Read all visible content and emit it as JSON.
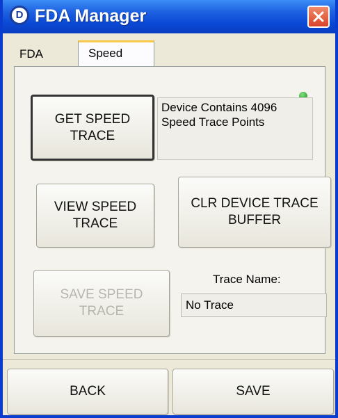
{
  "window": {
    "title": "FDA Manager",
    "icon_name": "device-d-icon",
    "icon_letter": "D",
    "close_icon": "close-icon"
  },
  "tabs": [
    {
      "label": "FDA",
      "active": false
    },
    {
      "label": "Speed",
      "active": true
    }
  ],
  "status_indicator": {
    "color": "#2e9e2e",
    "icon": "green-status-led-icon"
  },
  "buttons": {
    "get_speed_trace": "GET SPEED\nTRACE",
    "view_speed_trace": "VIEW SPEED\nTRACE",
    "clr_device_trace_buffer": "CLR DEVICE TRACE\nBUFFER",
    "save_speed_trace": "SAVE SPEED\nTRACE",
    "back": "BACK",
    "save": "SAVE"
  },
  "device_info": "Device Contains 4096\nSpeed Trace Points",
  "trace_name": {
    "label": "Trace Name:",
    "value": "No Trace"
  },
  "colors": {
    "titlebar": "#0a49d5",
    "close_button": "#d9432a",
    "disabled_text": "#b6b5ac"
  }
}
